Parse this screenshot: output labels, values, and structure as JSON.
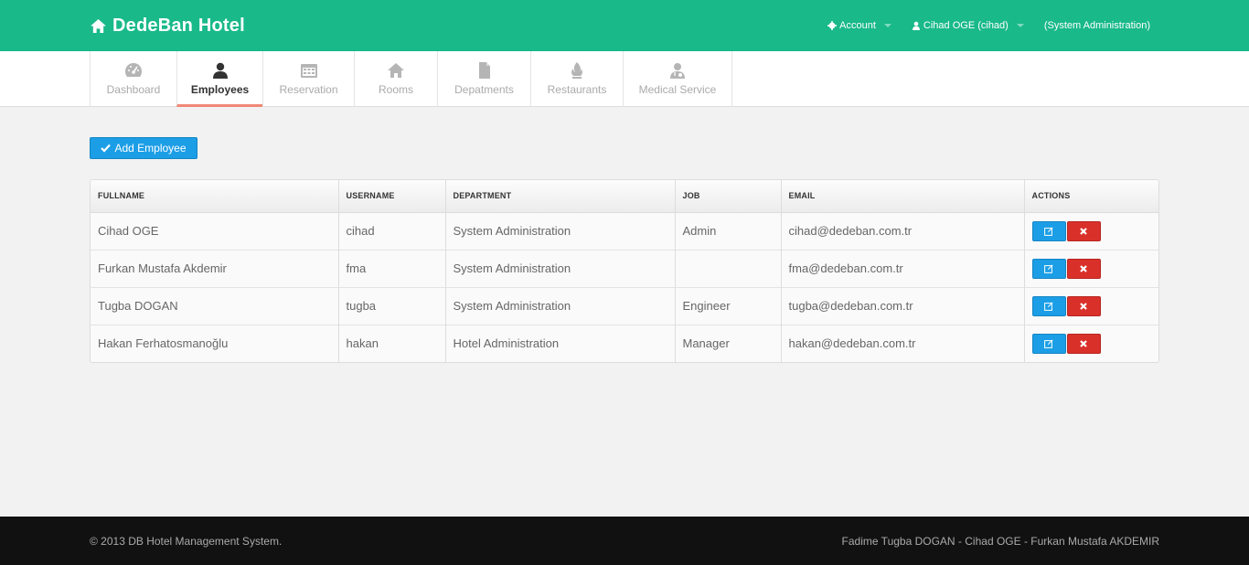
{
  "header": {
    "brand": "DedeBan Hotel",
    "account_label": "Account",
    "user_label": "Cihad OGE (cihad)",
    "role_label": "(System Administration)",
    "brand_color": "#19b98a"
  },
  "tabs": [
    {
      "label": "Dashboard",
      "icon": "dashboard-icon"
    },
    {
      "label": "Employees",
      "icon": "user-icon",
      "active": true
    },
    {
      "label": "Reservation",
      "icon": "calendar-icon"
    },
    {
      "label": "Rooms",
      "icon": "home-icon"
    },
    {
      "label": "Depatments",
      "icon": "file-icon"
    },
    {
      "label": "Restaurants",
      "icon": "fire-icon"
    },
    {
      "label": "Medical Service",
      "icon": "doctor-icon"
    }
  ],
  "main": {
    "add_button_label": "Add Employee",
    "columns": [
      "FULLNAME",
      "USERNAME",
      "DEPARTMENT",
      "JOB",
      "EMAIL",
      "ACTIONS"
    ],
    "rows": [
      {
        "fullname": "Cihad OGE",
        "username": "cihad",
        "department": "System Administration",
        "job": "Admin",
        "email": "cihad@dedeban.com.tr"
      },
      {
        "fullname": "Furkan Mustafa Akdemir",
        "username": "fma",
        "department": "System Administration",
        "job": "",
        "email": "fma@dedeban.com.tr"
      },
      {
        "fullname": "Tugba DOGAN",
        "username": "tugba",
        "department": "System Administration",
        "job": "Engineer",
        "email": "tugba@dedeban.com.tr"
      },
      {
        "fullname": "Hakan Ferhatosmanoğlu",
        "username": "hakan",
        "department": "Hotel Administration",
        "job": "Manager",
        "email": "hakan@dedeban.com.tr"
      }
    ]
  },
  "footer": {
    "copyright": "© 2013 DB Hotel Management System.",
    "authors": "Fadime Tugba DOGAN - Cihad OGE - Furkan Mustafa AKDEMIR"
  }
}
